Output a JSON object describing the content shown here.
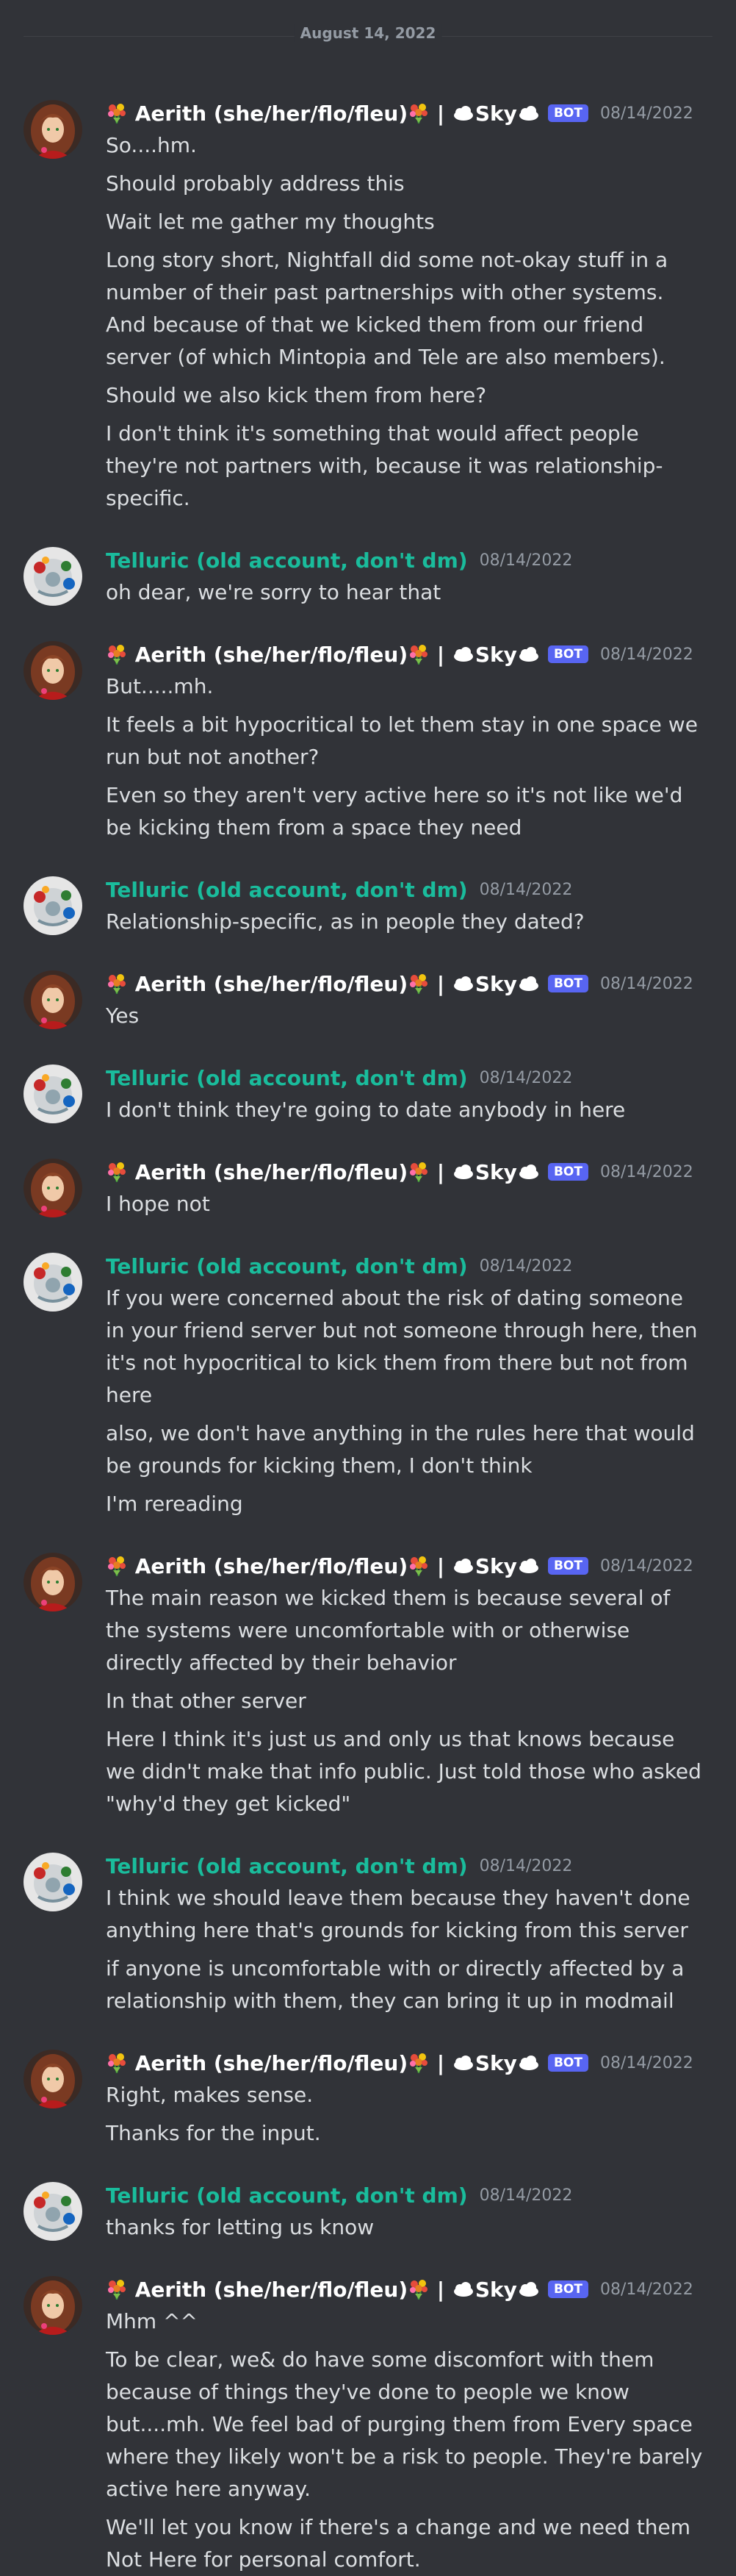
{
  "date_divider": "August 14, 2022",
  "users": {
    "aerith": {
      "name_prefix": "Aerith (she/her/flo/fleu)",
      "name_suffix": "| ",
      "sky_label": "Sky",
      "bot_badge": "BOT",
      "icons": [
        "bouquet-emoji",
        "cloud-emoji"
      ]
    },
    "telluric": {
      "name": "Telluric (old account, don't dm)"
    }
  },
  "messages": [
    {
      "author": "aerith",
      "timestamp": "08/14/2022",
      "lines": [
        "So....hm.",
        "Should probably address this",
        "Wait let me gather my thoughts",
        "Long story short, Nightfall did some not-okay stuff in a number of their past partnerships with other systems. And because of that we kicked them from our friend server (of which Mintopia and Tele are also members).",
        "Should we also kick them from here?",
        "I don't think it's something that would affect people they're not partners with, because it was relationship-specific."
      ]
    },
    {
      "author": "telluric",
      "timestamp": "08/14/2022",
      "lines": [
        "oh dear, we're sorry to hear that"
      ]
    },
    {
      "author": "aerith",
      "timestamp": "08/14/2022",
      "lines": [
        "But.....mh.",
        "It feels a bit hypocritical to let them stay in one space we run but not another?",
        "Even so they aren't very active here so it's not like we'd be kicking them from a space they need"
      ]
    },
    {
      "author": "telluric",
      "timestamp": "08/14/2022",
      "lines": [
        "Relationship-specific, as in people they dated?"
      ]
    },
    {
      "author": "aerith",
      "timestamp": "08/14/2022",
      "lines": [
        "Yes"
      ]
    },
    {
      "author": "telluric",
      "timestamp": "08/14/2022",
      "lines": [
        "I don't think they're going to date anybody in here"
      ]
    },
    {
      "author": "aerith",
      "timestamp": "08/14/2022",
      "lines": [
        "I hope not"
      ]
    },
    {
      "author": "telluric",
      "timestamp": "08/14/2022",
      "lines": [
        "If you were concerned about the risk of dating someone in your friend server but not someone through here, then it's not hypocritical to kick them from there but not from here",
        "also, we don't have anything in the rules here that would be grounds for kicking them, I don't think",
        "I'm rereading"
      ]
    },
    {
      "author": "aerith",
      "timestamp": "08/14/2022",
      "lines": [
        "The main reason we kicked them is because several of the systems were uncomfortable with or otherwise directly affected by their behavior",
        "In that other server",
        "Here I think it's just us and only us that knows because we didn't make that info public. Just told those who asked \"why'd they get kicked\""
      ]
    },
    {
      "author": "telluric",
      "timestamp": "08/14/2022",
      "lines": [
        "I think we should leave them because they haven't done anything here that's grounds for kicking from this server",
        "if anyone is uncomfortable with or directly affected by a relationship with them, they can bring it up in modmail"
      ]
    },
    {
      "author": "aerith",
      "timestamp": "08/14/2022",
      "lines": [
        "Right, makes sense.",
        "Thanks for the input."
      ]
    },
    {
      "author": "telluric",
      "timestamp": "08/14/2022",
      "lines": [
        "thanks for letting us know"
      ]
    },
    {
      "author": "aerith",
      "timestamp": "08/14/2022",
      "lines": [
        "Mhm ^^",
        "To be clear, we& do have some discomfort with them because of things they've done to people we know but....mh. We feel bad of purging them from Every space where they likely won't be a risk to people. They're barely active here anyway.",
        "We'll let you know if there's a change and we need them Not Here for personal comfort."
      ]
    }
  ]
}
